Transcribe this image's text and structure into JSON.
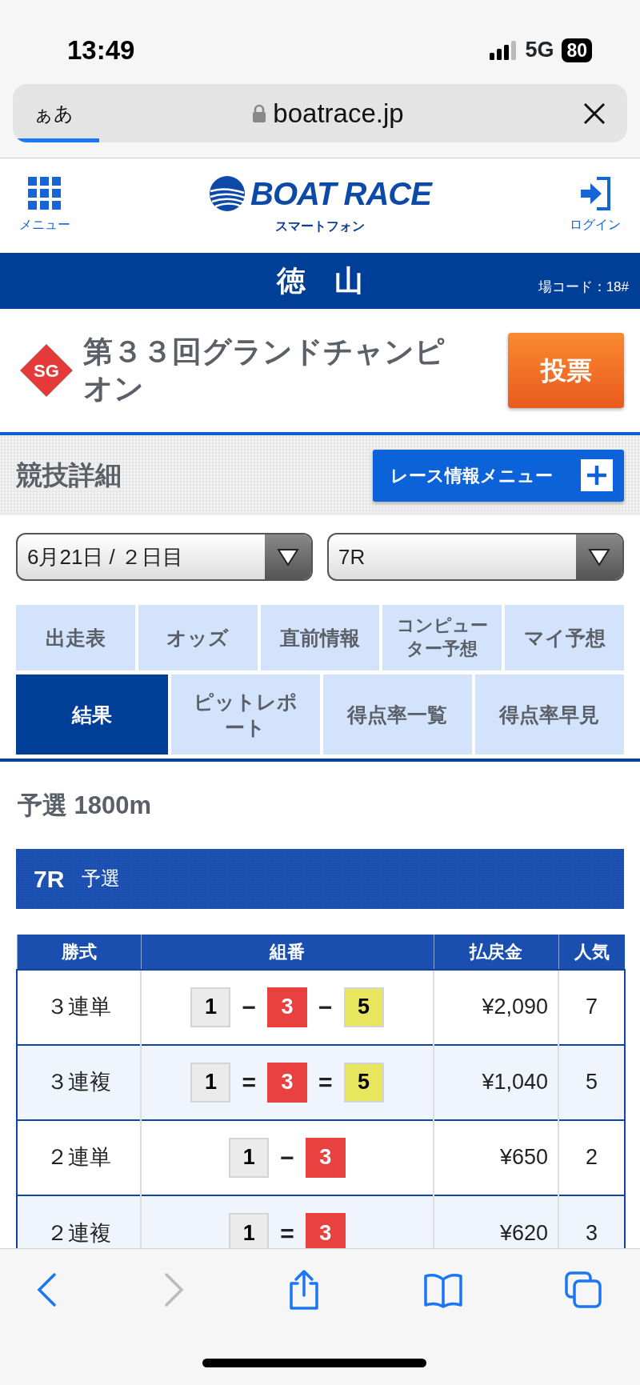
{
  "status_bar": {
    "time": "13:49",
    "network": "5G",
    "battery": "80"
  },
  "browser": {
    "text_size_button": "ぁあ",
    "url": "boatrace.jp",
    "load_progress": {
      "level": 0.14
    }
  },
  "header": {
    "menu_label": "メニュー",
    "logo_text": "BOAT RACE",
    "logo_sub": "スマートフォン",
    "login_label": "ログイン"
  },
  "venue": {
    "name": "徳　山",
    "code": "場コード：18#"
  },
  "race_title": {
    "grade": "SG",
    "title": "第３３回グランドチャンピオン",
    "vote_button": "投票"
  },
  "section": {
    "title": "競技詳細",
    "menu_button": "レース情報メニュー"
  },
  "selects": [
    {
      "value": "6月21日 / ２日目"
    },
    {
      "value": "7R"
    }
  ],
  "tabs": [
    [
      {
        "label": "出走表",
        "selected": false
      },
      {
        "label": "オッズ",
        "selected": false
      },
      {
        "label": "直前情報",
        "selected": false
      },
      {
        "label": "コンピューター予想",
        "selected": false
      },
      {
        "label": "マイ予想",
        "selected": false
      }
    ],
    [
      {
        "label": "結果",
        "selected": true
      },
      {
        "label": "ピットレポート",
        "selected": false
      },
      {
        "label": "得点率一覧",
        "selected": false
      },
      {
        "label": "得点率早見",
        "selected": false
      }
    ]
  ],
  "distance": "予選 1800m",
  "race_bar": {
    "number": "7R",
    "type": "予選"
  },
  "table": {
    "columns": [
      "勝式",
      "組番",
      "払戻金",
      "人気"
    ],
    "rows": [
      {
        "bet_type": "３連単",
        "combination": [
          {
            "number": "1",
            "color": "#ebebeb"
          },
          {
            "number": "3",
            "color": "#e8413f"
          },
          {
            "number": "5",
            "color": "#e8e65e"
          }
        ],
        "separator": "−",
        "payout": "¥2,090",
        "popularity": "7"
      },
      {
        "bet_type": "３連複",
        "combination": [
          {
            "number": "1",
            "color": "#ebebeb"
          },
          {
            "number": "3",
            "color": "#e8413f"
          },
          {
            "number": "5",
            "color": "#e8e65e"
          }
        ],
        "separator": "=",
        "payout": "¥1,040",
        "popularity": "5"
      },
      {
        "bet_type": "２連単",
        "combination": [
          {
            "number": "1",
            "color": "#ebebeb"
          },
          {
            "number": "3",
            "color": "#e8413f"
          }
        ],
        "separator": "−",
        "payout": "¥650",
        "popularity": "2"
      },
      {
        "bet_type": "２連複",
        "combination": [
          {
            "number": "1",
            "color": "#ebebeb"
          },
          {
            "number": "3",
            "color": "#e8413f"
          }
        ],
        "separator": "=",
        "payout": "¥620",
        "popularity": "3"
      }
    ]
  }
}
